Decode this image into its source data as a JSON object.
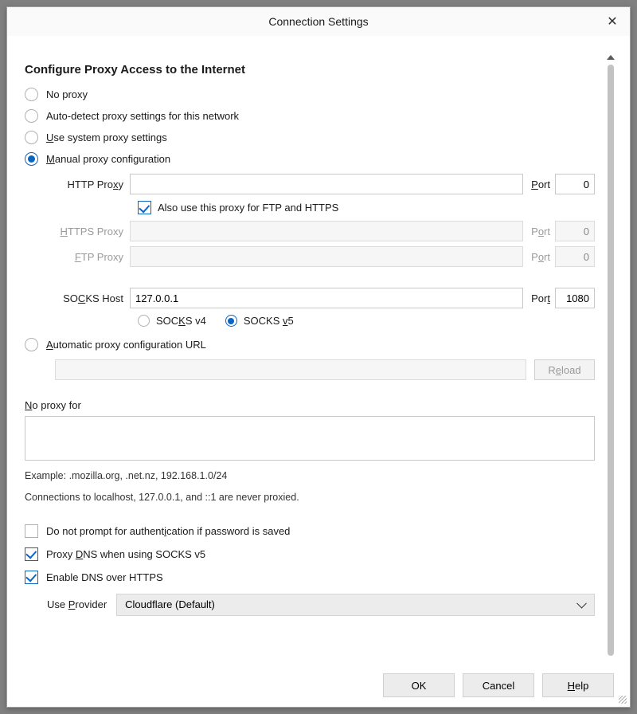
{
  "window": {
    "title": "Connection Settings"
  },
  "heading": "Configure Proxy Access to the Internet",
  "radio": {
    "no_proxy": "No proxy",
    "auto_detect": "Auto-detect proxy settings for this network",
    "system_pre": "",
    "system_u": "U",
    "system_post": "se system proxy settings",
    "manual_pre": "",
    "manual_u": "M",
    "manual_post": "anual proxy configuration",
    "auto_url_pre": "",
    "auto_url_u": "A",
    "auto_url_post": "utomatic proxy configuration URL"
  },
  "proxy": {
    "http_label_pre": "HTTP Pro",
    "http_label_u": "x",
    "http_label_post": "y",
    "http_value": "",
    "http_port": "0",
    "also_use": "Also use this proxy for FTP and HTTPS",
    "https_label_pre": "",
    "https_label_u": "H",
    "https_label_post": "TTPS Proxy",
    "https_value": "",
    "https_port_label_pre": "P",
    "https_port_label_u": "o",
    "https_port_label_post": "rt",
    "https_port": "0",
    "ftp_label_pre": "",
    "ftp_label_u": "F",
    "ftp_label_post": "TP Proxy",
    "ftp_value": "",
    "ftp_port": "0",
    "socks_label_pre": "SO",
    "socks_label_u": "C",
    "socks_label_post": "KS Host",
    "socks_value": "127.0.0.1",
    "socks_port_label_pre": "Por",
    "socks_port_label_u": "t",
    "socks_port": "1080",
    "socksv4_pre": "SOC",
    "socksv4_u": "K",
    "socksv4_post": "S v4",
    "socksv5_pre": "SOCKS ",
    "socksv5_u": "v",
    "socksv5_post": "5",
    "port_label_plain_pre": "",
    "port_label_plain_u": "P",
    "port_label_plain_post": "ort"
  },
  "pac": {
    "url_value": ""
  },
  "buttons": {
    "reload_pre": "R",
    "reload_u": "e",
    "reload_post": "load",
    "ok": "OK",
    "cancel": "Cancel",
    "help_u": "H",
    "help_post": "elp"
  },
  "no_proxy_for": {
    "label_pre": "",
    "label_u": "N",
    "label_post": "o proxy for",
    "value": "",
    "example": "Example: .mozilla.org, .net.nz, 192.168.1.0/24",
    "localhost_note": "Connections to localhost, 127.0.0.1, and ::1 are never proxied."
  },
  "checks": {
    "no_prompt_pre": "Do not prompt for authent",
    "no_prompt_u": "i",
    "no_prompt_post": "cation if password is saved",
    "proxy_dns_pre": "Proxy ",
    "proxy_dns_u": "D",
    "proxy_dns_post": "NS when using SOCKS v5",
    "doh_pre": "Enable DNS over HTTPS",
    "doh_u": "",
    "doh_post": ""
  },
  "provider": {
    "label_pre": "Use ",
    "label_u": "P",
    "label_post": "rovider",
    "selected": "Cloudflare (Default)"
  }
}
